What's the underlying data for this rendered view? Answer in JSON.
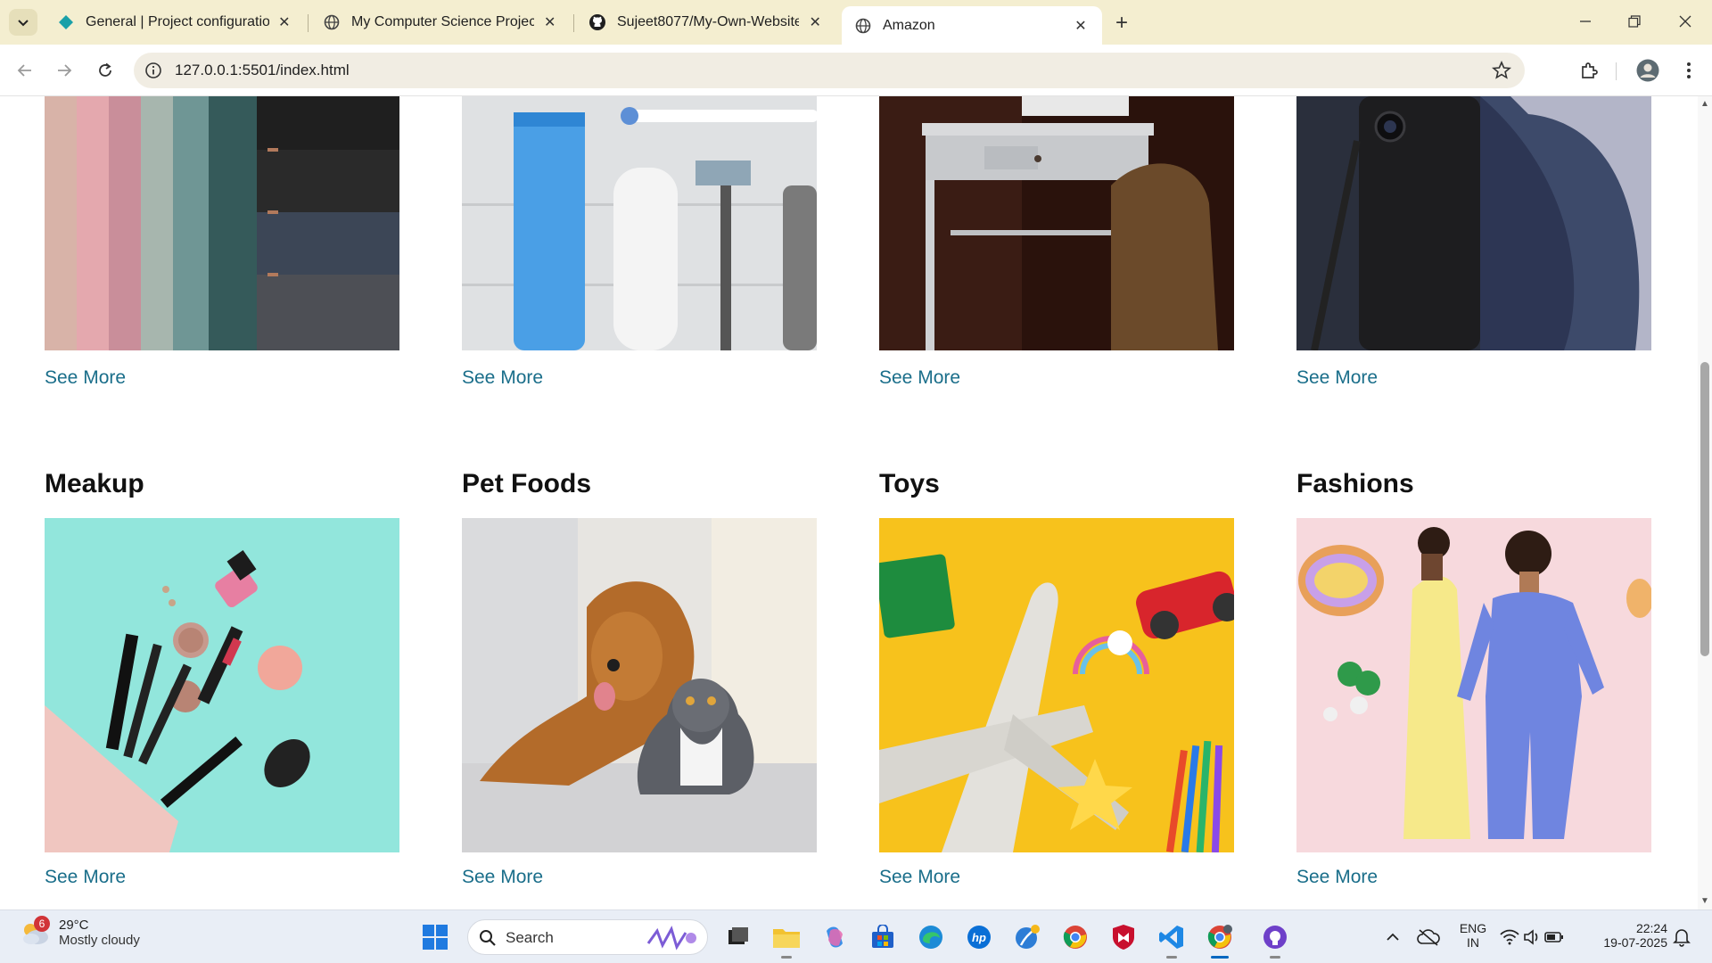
{
  "browser": {
    "tabs": [
      {
        "title": "General | Project configuration |",
        "icon": "project-diamond-icon",
        "active": false
      },
      {
        "title": "My Computer Science Projects",
        "icon": "globe-icon",
        "active": false
      },
      {
        "title": "Sujeet8077/My-Own-Website",
        "icon": "github-icon",
        "active": false
      },
      {
        "title": "Amazon",
        "icon": "globe-icon",
        "active": true
      }
    ],
    "close_glyph": "✕",
    "new_tab_glyph": "+",
    "url": "127.0.0.1:5501/index.html"
  },
  "page": {
    "top_row": [
      {
        "see_more": "See More",
        "image": "fabric-swatches"
      },
      {
        "see_more": "See More",
        "image": "personal-care-products"
      },
      {
        "see_more": "See More",
        "image": "desk-furniture"
      },
      {
        "see_more": "See More",
        "image": "smartphone"
      }
    ],
    "bottom_row": [
      {
        "title": "Meakup",
        "see_more": "See More",
        "image": "makeup"
      },
      {
        "title": "Pet Foods",
        "see_more": "See More",
        "image": "dog-and-cat"
      },
      {
        "title": "Toys",
        "see_more": "See More",
        "image": "toys"
      },
      {
        "title": "Fashions",
        "see_more": "See More",
        "image": "fashion-models"
      }
    ]
  },
  "taskbar": {
    "weather": {
      "badge": "6",
      "temp": "29°C",
      "condition": "Mostly cloudy"
    },
    "search_label": "Search",
    "language": {
      "line1": "ENG",
      "line2": "IN"
    },
    "clock": {
      "time": "22:24",
      "date": "19-07-2025"
    }
  },
  "colors": {
    "tabstrip_bg": "#f4eed0",
    "link": "#1a6e8a",
    "taskbar_bg": "#e9eef6"
  }
}
